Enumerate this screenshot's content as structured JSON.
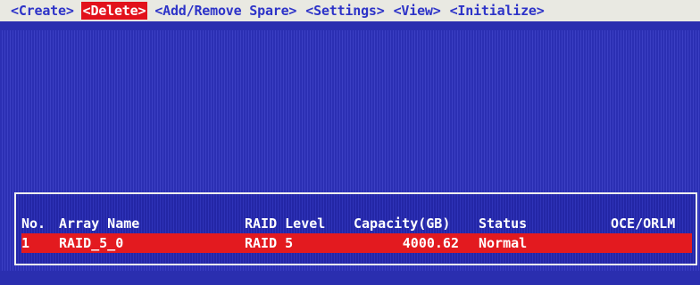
{
  "menu": {
    "items": [
      {
        "label": "<Create>",
        "selected": false
      },
      {
        "label": "<Delete>",
        "selected": true
      },
      {
        "label": "<Add/Remove Spare>",
        "selected": false
      },
      {
        "label": "<Settings>",
        "selected": false
      },
      {
        "label": "<View>",
        "selected": false
      },
      {
        "label": "<Initialize>",
        "selected": false
      }
    ]
  },
  "table": {
    "columns": [
      "No.",
      "Array Name",
      "RAID Level",
      "Capacity(GB)",
      "Status",
      "OCE/ORLM"
    ],
    "rows": [
      {
        "no": "1",
        "name": "RAID_5_0",
        "raid_level": "RAID 5",
        "capacity": "4000.62",
        "status": "Normal",
        "oce": ""
      }
    ]
  },
  "colors": {
    "background": "#2c2fb0",
    "menu_bg": "#e9e9e2",
    "menu_text": "#2d33c8",
    "selected": "#e2121b",
    "text": "#ffffff"
  }
}
